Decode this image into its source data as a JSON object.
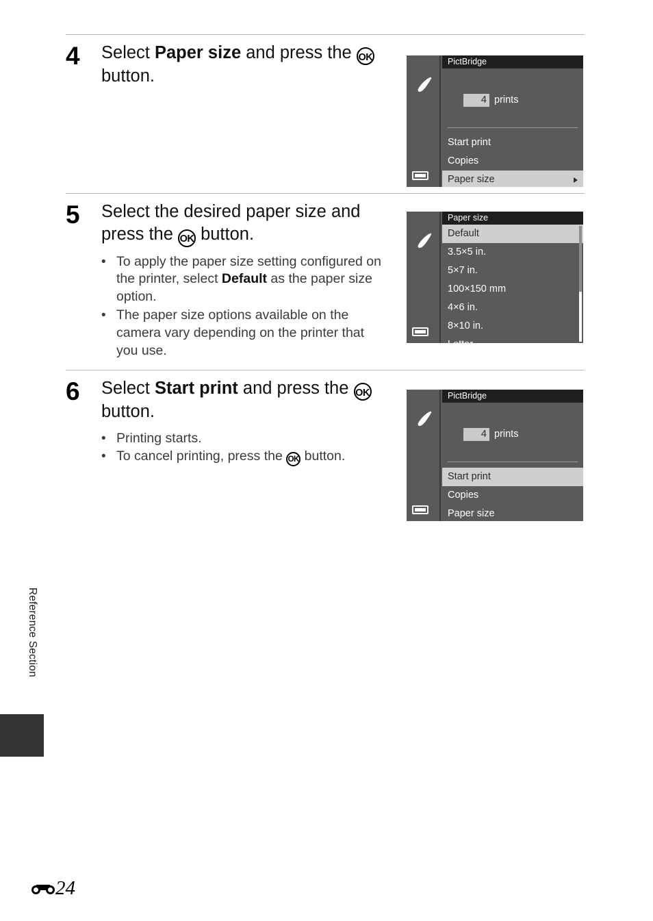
{
  "page": {
    "section_label": "Reference Section",
    "page_number": "24",
    "ref_marker_name": "reference-section-marker"
  },
  "steps": [
    {
      "number": "4",
      "heading_parts": [
        {
          "text": "Select ",
          "bold": false
        },
        {
          "text": "Paper size",
          "bold": true
        },
        {
          "text": " and press the ",
          "bold": false
        },
        {
          "text": "OK",
          "icon": true
        },
        {
          "text": " button.",
          "bold": false
        }
      ],
      "bullets": []
    },
    {
      "number": "5",
      "heading_parts": [
        {
          "text": "Select the desired paper size and press the ",
          "bold": false
        },
        {
          "text": "OK",
          "icon": true
        },
        {
          "text": " button.",
          "bold": false
        }
      ],
      "bullets": [
        [
          {
            "text": "To apply the paper size setting configured on the printer, select ",
            "bold": false
          },
          {
            "text": "Default",
            "bold": true
          },
          {
            "text": " as the paper size option.",
            "bold": false
          }
        ],
        [
          {
            "text": "The paper size options available on the camera vary depending on the printer that you use.",
            "bold": false
          }
        ]
      ]
    },
    {
      "number": "6",
      "heading_parts": [
        {
          "text": "Select ",
          "bold": false
        },
        {
          "text": "Start print",
          "bold": true
        },
        {
          "text": " and press the ",
          "bold": false
        },
        {
          "text": "OK",
          "icon": true
        },
        {
          "text": " button.",
          "bold": false
        }
      ],
      "bullets": [
        [
          {
            "text": "Printing starts.",
            "bold": false
          }
        ],
        [
          {
            "text": "To cancel printing, press the ",
            "bold": false
          },
          {
            "text": "OK",
            "icon": true
          },
          {
            "text": " button.",
            "bold": false
          }
        ]
      ]
    }
  ],
  "screens": {
    "pictbridge_paper_size_selected": {
      "title": "PictBridge",
      "prints_count": "4",
      "prints_label": "prints",
      "sidebar_icon": "pictbridge-icon",
      "battery_icon": "battery-icon",
      "menu": [
        {
          "label": "Start print",
          "selected": false,
          "arrow": false
        },
        {
          "label": "Copies",
          "selected": false,
          "arrow": false
        },
        {
          "label": "Paper size",
          "selected": true,
          "arrow": true
        }
      ]
    },
    "paper_size_list": {
      "title": "Paper size",
      "sidebar_icon": "pictbridge-icon",
      "battery_icon": "battery-icon",
      "items": [
        {
          "label": "Default",
          "selected": true
        },
        {
          "label": "3.5×5 in.",
          "selected": false
        },
        {
          "label": "5×7 in.",
          "selected": false
        },
        {
          "label": "100×150 mm",
          "selected": false
        },
        {
          "label": "4×6 in.",
          "selected": false
        },
        {
          "label": "8×10 in.",
          "selected": false
        },
        {
          "label": "Letter",
          "selected": false
        }
      ]
    },
    "pictbridge_start_print_selected": {
      "title": "PictBridge",
      "prints_count": "4",
      "prints_label": "prints",
      "sidebar_icon": "pictbridge-icon",
      "battery_icon": "battery-icon",
      "menu": [
        {
          "label": "Start print",
          "selected": true,
          "arrow": false
        },
        {
          "label": "Copies",
          "selected": false,
          "arrow": false
        },
        {
          "label": "Paper size",
          "selected": false,
          "arrow": false
        }
      ]
    }
  },
  "colors": {
    "screen_background": "#5a5a5a",
    "screen_title_bar": "#201f1f",
    "screen_highlight": "#cfcfcf",
    "rule": "#b9b9b9",
    "side_tab": "#333333"
  }
}
